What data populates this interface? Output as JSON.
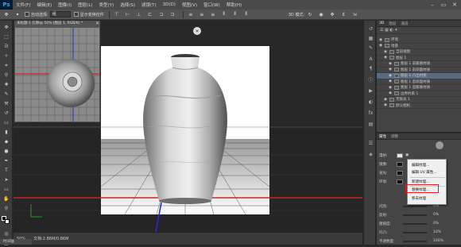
{
  "app": {
    "logo": "Ps"
  },
  "menu": {
    "items": [
      "文件(F)",
      "编辑(E)",
      "图像(I)",
      "图层(L)",
      "类型(Y)",
      "选择(S)",
      "滤镜(T)",
      "3D(D)",
      "视图(V)",
      "窗口(W)",
      "帮助(H)"
    ]
  },
  "window_controls": {
    "minimize": "–",
    "restore": "▭",
    "close": "✕"
  },
  "options": {
    "auto_select_label": "自动选择:",
    "auto_select_value": "组",
    "show_transform_label": "显示变换控件",
    "mode_3d_label": "3D 模式:"
  },
  "document": {
    "tab_title": "未标题-1 孔隙@ 50% (图层 1, RGB/8) *",
    "close_label": "✕",
    "canvas_close": "✕"
  },
  "status": {
    "zoom": "50%",
    "doc_info": "文档:2.86M/0.86M",
    "tab": "时间轴"
  },
  "layers_panel": {
    "tabs": [
      "3D",
      "图层",
      "通道"
    ],
    "toolbar_label": "☰ ▦ ◐ ✦",
    "rows": [
      {
        "label": "环境",
        "indent": 0,
        "selected": false
      },
      {
        "label": "场景",
        "indent": 0,
        "selected": false
      },
      {
        "label": "当前视图",
        "indent": 1,
        "selected": false
      },
      {
        "label": "图层 1",
        "indent": 1,
        "selected": false
      },
      {
        "label": "图层 1 前膨胀材质",
        "indent": 2,
        "selected": false
      },
      {
        "label": "图层 1 前斜面材质",
        "indent": 2,
        "selected": false
      },
      {
        "label": "图层 1 凸出材质",
        "indent": 2,
        "selected": true
      },
      {
        "label": "图层 1 后斜面材质",
        "indent": 2,
        "selected": false
      },
      {
        "label": "图层 1 后膨胀材质",
        "indent": 2,
        "selected": false
      },
      {
        "label": "边界约束 1",
        "indent": 2,
        "selected": false
      },
      {
        "label": "无限光 1",
        "indent": 1,
        "selected": false
      },
      {
        "label": "默认相机",
        "indent": 1,
        "selected": false
      }
    ]
  },
  "properties_panel": {
    "tabs": [
      "属性",
      "调整"
    ],
    "rows": [
      {
        "label": "漫射:"
      },
      {
        "label": "镜像:"
      },
      {
        "label": "发光:"
      },
      {
        "label": "环境:"
      }
    ],
    "bottom_rows": [
      {
        "label": "闪亮:",
        "value": "0%"
      },
      {
        "label": "反射:",
        "value": "0%"
      },
      {
        "label": "粗糙度:",
        "value": "0%"
      },
      {
        "label": "凹凸:",
        "value": "10%"
      },
      {
        "label": "不透明度:",
        "value": "100%"
      }
    ]
  },
  "context_menu": {
    "items": [
      "编辑纹理...",
      "编辑 UV 属性...",
      "新建纹理...",
      "替换纹理...",
      "移去纹理"
    ]
  }
}
